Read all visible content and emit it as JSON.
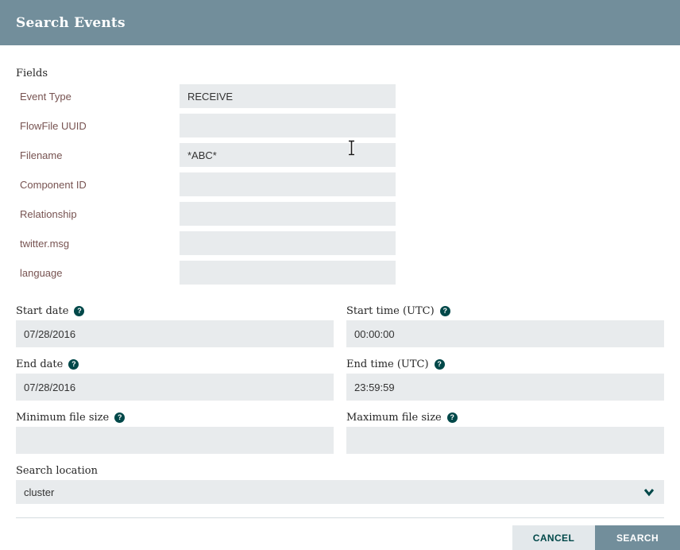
{
  "header": {
    "title": "Search Events"
  },
  "fields_section": {
    "heading": "Fields",
    "rows": [
      {
        "label": "Event Type",
        "value": "RECEIVE"
      },
      {
        "label": "FlowFile UUID",
        "value": ""
      },
      {
        "label": "Filename",
        "value": "*ABC*"
      },
      {
        "label": "Component ID",
        "value": ""
      },
      {
        "label": "Relationship",
        "value": ""
      },
      {
        "label": "twitter.msg",
        "value": ""
      },
      {
        "label": "language",
        "value": ""
      }
    ]
  },
  "datetime": {
    "start_date": {
      "label": "Start date",
      "value": "07/28/2016"
    },
    "start_time": {
      "label": "Start time (UTC)",
      "value": "00:00:00"
    },
    "end_date": {
      "label": "End date",
      "value": "07/28/2016"
    },
    "end_time": {
      "label": "End time (UTC)",
      "value": "23:59:59"
    }
  },
  "file_size": {
    "min": {
      "label": "Minimum file size",
      "value": ""
    },
    "max": {
      "label": "Maximum file size",
      "value": ""
    }
  },
  "search_location": {
    "label": "Search location",
    "value": "cluster"
  },
  "footer": {
    "cancel_label": "CANCEL",
    "search_label": "SEARCH"
  },
  "icons": {
    "help": "question-circle-icon",
    "help_glyph": "?",
    "dropdown": "chevron-down-icon"
  },
  "colors": {
    "header_bg": "#728e9b",
    "input_bg": "#e8ebed",
    "field_label": "#775351",
    "help_icon": "#004849",
    "cancel_bg": "#e3e8eb",
    "cancel_text": "#004849",
    "search_bg": "#728e9b",
    "search_text": "#ffffff"
  }
}
